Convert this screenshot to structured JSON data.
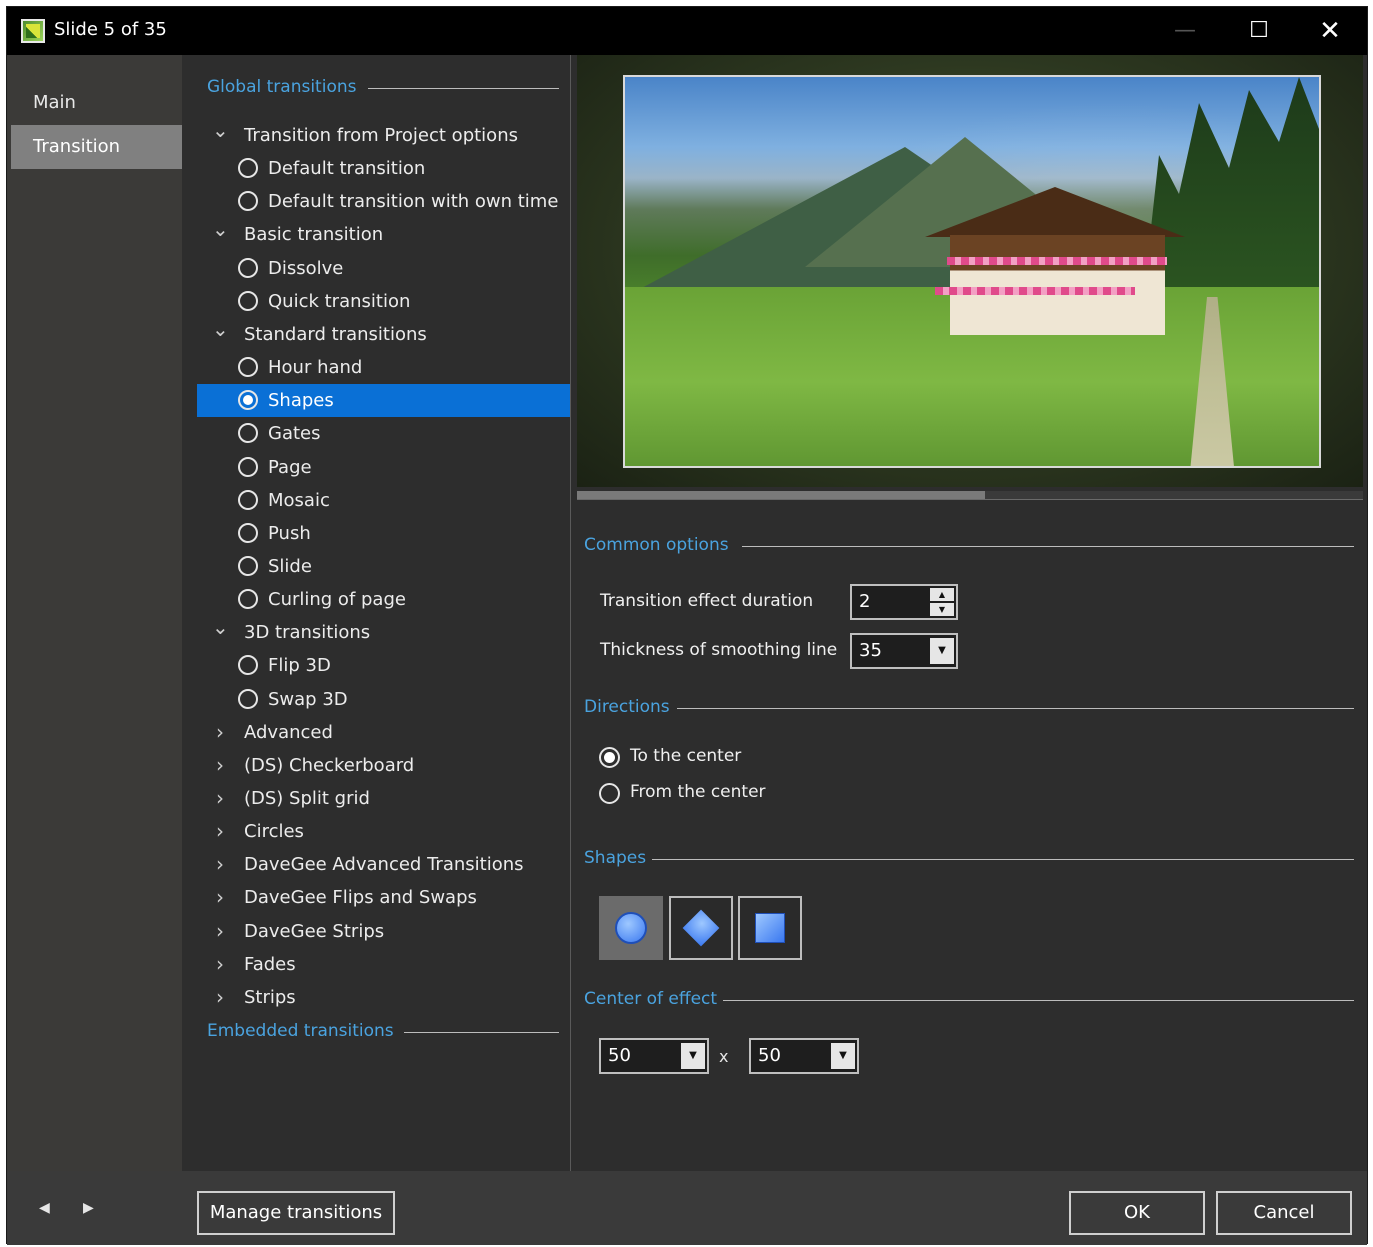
{
  "window": {
    "title": "Slide 5 of 35",
    "min_icon": "minimize-icon",
    "max_icon": "maximize-icon",
    "close_icon": "close-icon"
  },
  "leftnav": {
    "items": [
      {
        "label": "Main"
      },
      {
        "label": "Transition",
        "selected": true
      }
    ]
  },
  "tree": {
    "global_header": "Global transitions",
    "embedded_header": "Embedded transitions",
    "rows": [
      {
        "type": "group",
        "expanded": true,
        "label": "Transition from Project options"
      },
      {
        "type": "radio",
        "label": "Default transition"
      },
      {
        "type": "radio",
        "label": "Default transition with own time"
      },
      {
        "type": "group",
        "expanded": true,
        "label": "Basic transition"
      },
      {
        "type": "radio",
        "label": "Dissolve"
      },
      {
        "type": "radio",
        "label": "Quick transition"
      },
      {
        "type": "group",
        "expanded": true,
        "label": "Standard transitions"
      },
      {
        "type": "radio",
        "label": "Hour hand"
      },
      {
        "type": "radio",
        "label": "Shapes",
        "selected": true
      },
      {
        "type": "radio",
        "label": "Gates"
      },
      {
        "type": "radio",
        "label": "Page"
      },
      {
        "type": "radio",
        "label": "Mosaic"
      },
      {
        "type": "radio",
        "label": "Push"
      },
      {
        "type": "radio",
        "label": "Slide"
      },
      {
        "type": "radio",
        "label": "Curling of page"
      },
      {
        "type": "group",
        "expanded": true,
        "label": "3D transitions"
      },
      {
        "type": "radio",
        "label": "Flip 3D"
      },
      {
        "type": "radio",
        "label": "Swap 3D"
      },
      {
        "type": "group",
        "expanded": false,
        "label": "Advanced"
      },
      {
        "type": "group",
        "expanded": false,
        "label": "(DS) Checkerboard"
      },
      {
        "type": "group",
        "expanded": false,
        "label": "(DS) Split grid"
      },
      {
        "type": "group",
        "expanded": false,
        "label": "Circles"
      },
      {
        "type": "group",
        "expanded": false,
        "label": "DaveGee Advanced Transitions"
      },
      {
        "type": "group",
        "expanded": false,
        "label": "DaveGee Flips and Swaps"
      },
      {
        "type": "group",
        "expanded": false,
        "label": "DaveGee Strips"
      },
      {
        "type": "group",
        "expanded": false,
        "label": "Fades"
      },
      {
        "type": "group",
        "expanded": false,
        "label": "Strips"
      }
    ]
  },
  "common_options": {
    "header": "Common options",
    "duration_label": "Transition effect duration",
    "duration_value": "2",
    "thickness_label": "Thickness of smoothing line",
    "thickness_value": "35"
  },
  "directions": {
    "header": "Directions",
    "options": [
      {
        "label": "To the center",
        "selected": true
      },
      {
        "label": "From the center",
        "selected": false
      }
    ]
  },
  "shapes": {
    "header": "Shapes",
    "items": [
      {
        "icon": "circle-shape-icon",
        "selected": true
      },
      {
        "icon": "diamond-shape-icon",
        "selected": false
      },
      {
        "icon": "square-shape-icon",
        "selected": false
      }
    ]
  },
  "center": {
    "header": "Center of effect",
    "x_value": "50",
    "separator": "x",
    "y_value": "50"
  },
  "bottom": {
    "manage_label": "Manage transitions",
    "ok_label": "OK",
    "cancel_label": "Cancel"
  },
  "colors": {
    "accent": "#4aa3df",
    "selection": "#0a70d6",
    "background": "#2d2d2d"
  }
}
